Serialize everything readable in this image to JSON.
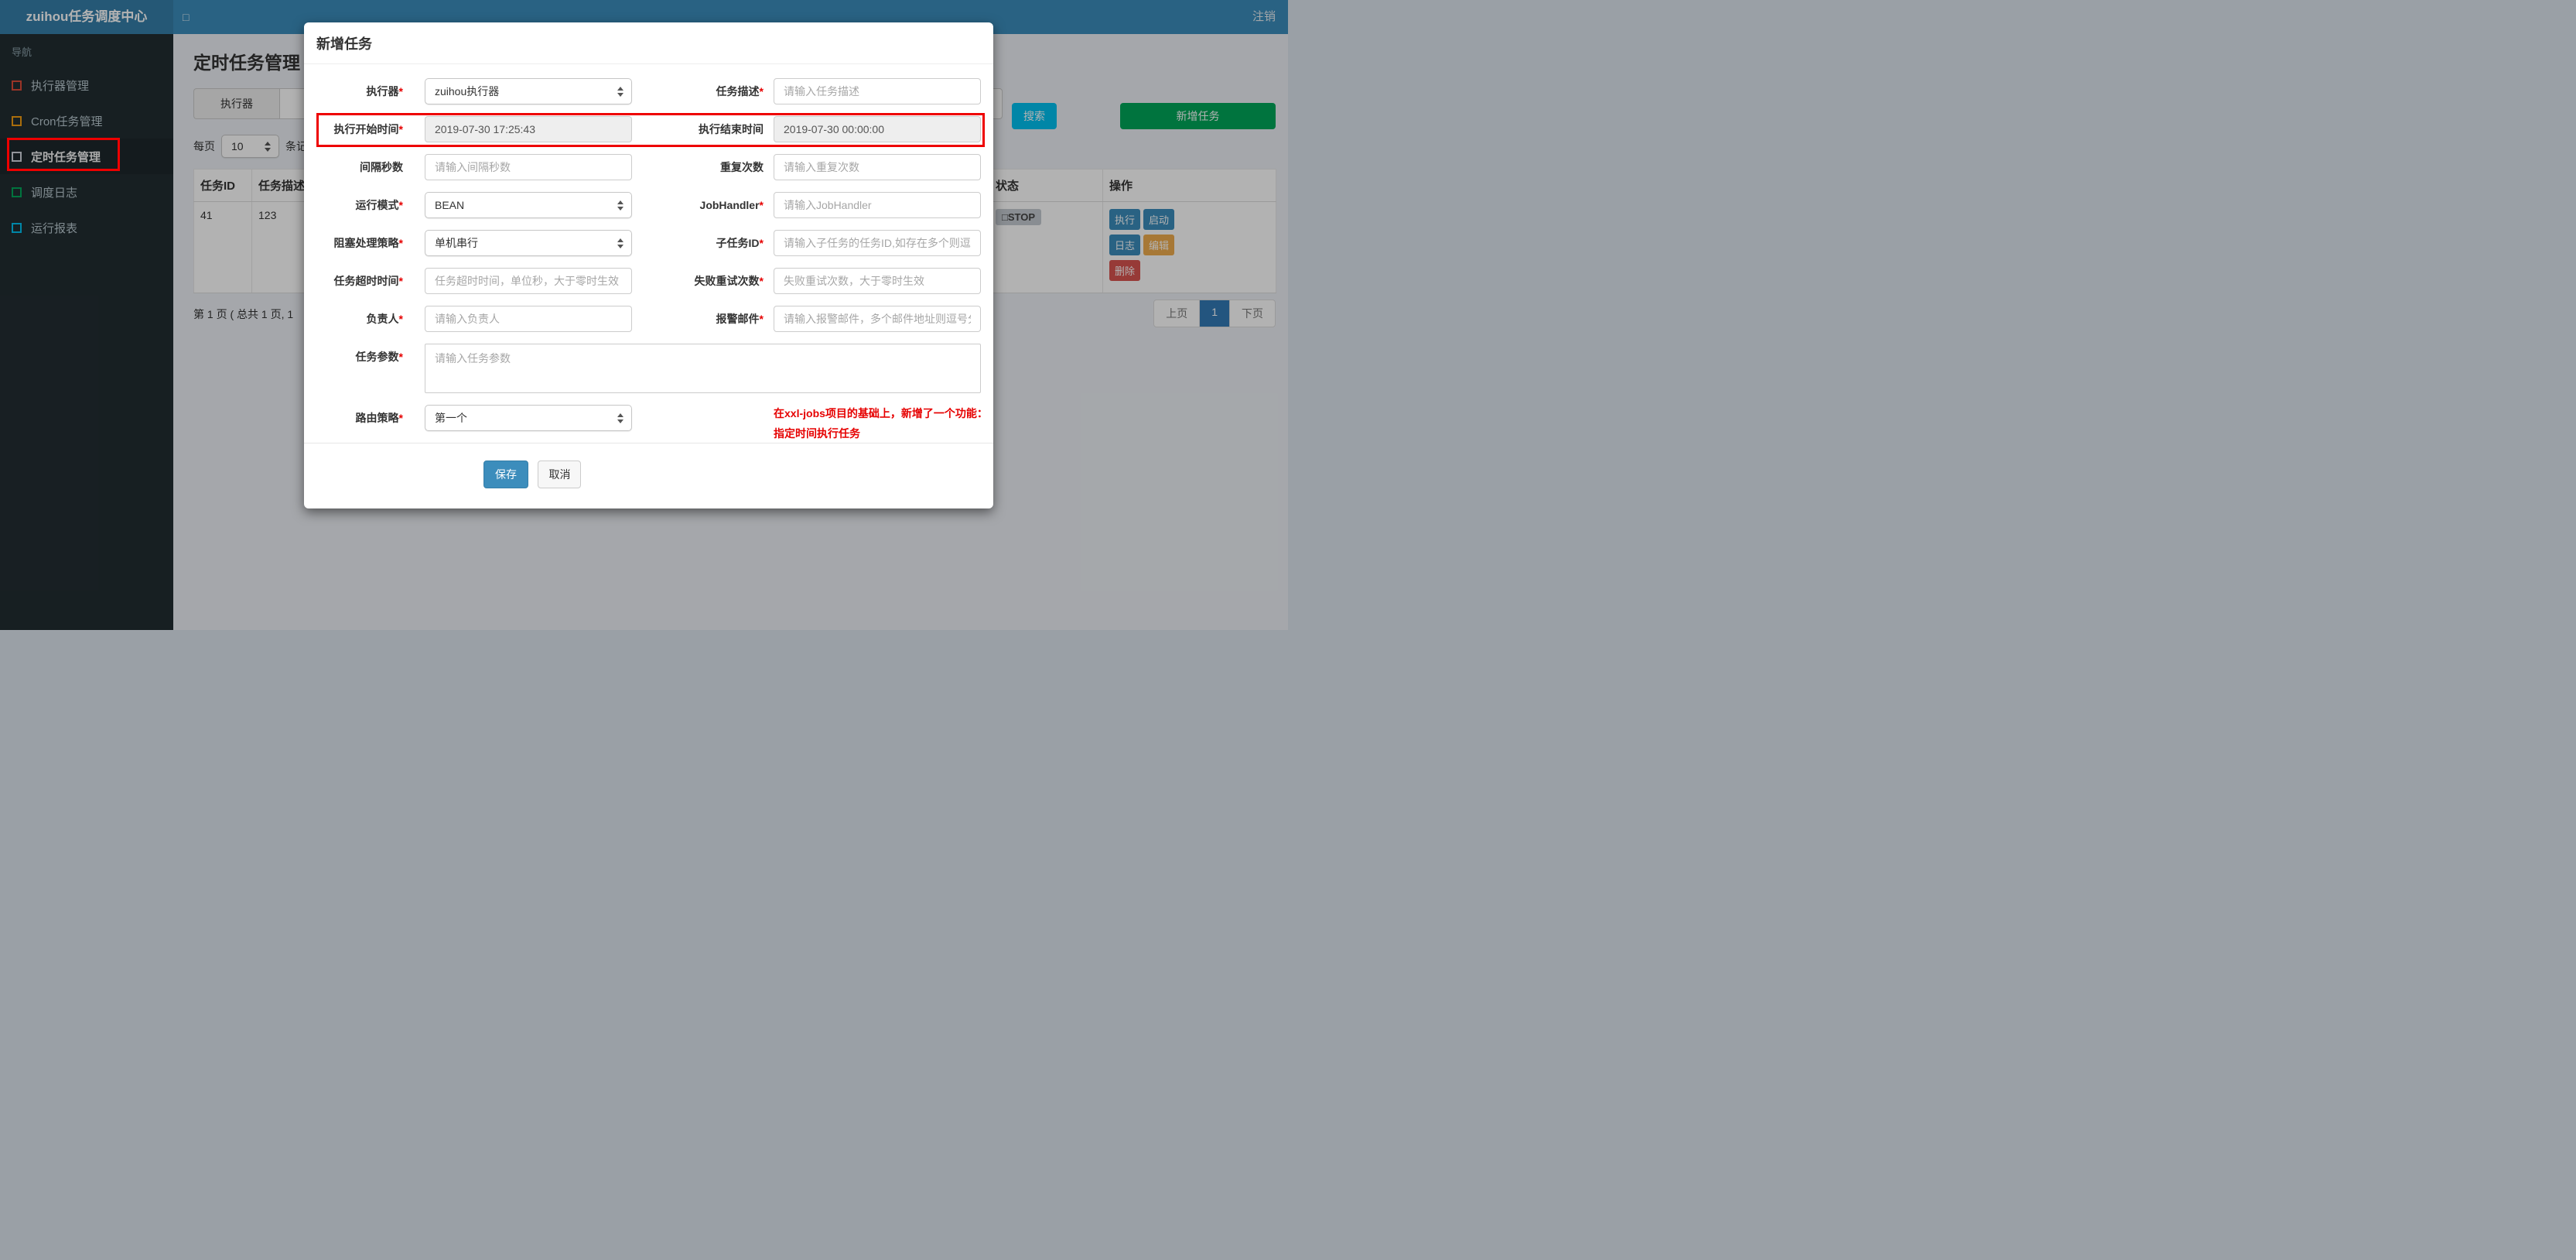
{
  "navbar": {
    "brand": "zuihou任务调度中心",
    "toggle_icon": "□",
    "logout": "注销"
  },
  "sidebar": {
    "header": "导航",
    "items": [
      {
        "label": "执行器管理",
        "icon": "square-outline-icon",
        "color": "#dd4b39"
      },
      {
        "label": "Cron任务管理",
        "icon": "square-outline-icon",
        "color": "#f39c12"
      },
      {
        "label": "定时任务管理",
        "icon": "square-outline-icon",
        "color": "#d2d6de",
        "active": true
      },
      {
        "label": "调度日志",
        "icon": "square-outline-icon",
        "color": "#00a65a"
      },
      {
        "label": "运行报表",
        "icon": "square-outline-icon",
        "color": "#00c0ef"
      }
    ]
  },
  "page": {
    "title": "定时任务管理",
    "toolbar": {
      "addon_label": "执行器",
      "search_button": "搜索",
      "add_button": "新增任务"
    },
    "per_page": {
      "prefix": "每页",
      "value": "10",
      "suffix": "条记"
    },
    "table": {
      "headers": [
        "任务ID",
        "任务描述",
        "状态",
        "操作"
      ],
      "row": {
        "id": "41",
        "desc": "123",
        "status_icon": "□",
        "status": "STOP",
        "actions": [
          "执行",
          "启动",
          "日志",
          "编辑",
          "删除"
        ]
      }
    },
    "pagination": {
      "summary": "第 1 页 ( 总共 1 页, 1",
      "prev": "上页",
      "current": "1",
      "next": "下页"
    }
  },
  "modal": {
    "title": "新增任务",
    "fields": {
      "executor": {
        "label": "执行器",
        "star": "*",
        "value": "zuihou执行器"
      },
      "desc": {
        "label": "任务描述",
        "star": "*",
        "placeholder": "请输入任务描述"
      },
      "start_time": {
        "label": "执行开始时间",
        "star": "*",
        "value": "2019-07-30 17:25:43"
      },
      "end_time": {
        "label": "执行结束时间",
        "star": "",
        "value": "2019-07-30 00:00:00"
      },
      "interval": {
        "label": "间隔秒数",
        "star": "",
        "placeholder": "请输入间隔秒数"
      },
      "repeat": {
        "label": "重复次数",
        "star": "",
        "placeholder": "请输入重复次数"
      },
      "run_mode": {
        "label": "运行模式",
        "star": "*",
        "value": "BEAN"
      },
      "job_handler": {
        "label": "JobHandler",
        "star": "*",
        "placeholder": "请输入JobHandler"
      },
      "block": {
        "label": "阻塞处理策略",
        "star": "*",
        "value": "单机串行"
      },
      "child_job": {
        "label": "子任务ID",
        "star": "*",
        "placeholder": "请输入子任务的任务ID,如存在多个则逗"
      },
      "timeout": {
        "label": "任务超时时间",
        "star": "*",
        "placeholder": "任务超时时间，单位秒，大于零时生效"
      },
      "retry": {
        "label": "失败重试次数",
        "star": "*",
        "placeholder": "失败重试次数，大于零时生效"
      },
      "owner": {
        "label": "负责人",
        "star": "*",
        "placeholder": "请输入负责人"
      },
      "email": {
        "label": "报警邮件",
        "star": "*",
        "placeholder": "请输入报警邮件，多个邮件地址则逗号分"
      },
      "params": {
        "label": "任务参数",
        "star": "*",
        "placeholder": "请输入任务参数"
      },
      "route": {
        "label": "路由策略",
        "star": "*",
        "value": "第一个"
      }
    },
    "note": {
      "line1": "在xxl-jobs项目的基础上，新增了一个功能：",
      "line2": "指定时间执行任务"
    },
    "buttons": {
      "save": "保存",
      "cancel": "取消"
    }
  },
  "colors": {
    "navbar": "#3c8dbc",
    "logo_bg": "#367fa9",
    "sidebar_bg": "#222d32",
    "search_btn": "#00c0ef",
    "add_btn": "#00a65a",
    "action_blue": "#3c8dbc",
    "edit_btn": "#f0ad4e",
    "delete_btn": "#d9534f",
    "active_page": "#337ab7",
    "annotation_red": "#ee0000",
    "note_red": "#e60000",
    "icon_red": "#dd4b39",
    "icon_orange": "#f39c12",
    "icon_gray": "#d2d6de",
    "icon_green": "#00a65a",
    "icon_cyan": "#00c0ef"
  }
}
